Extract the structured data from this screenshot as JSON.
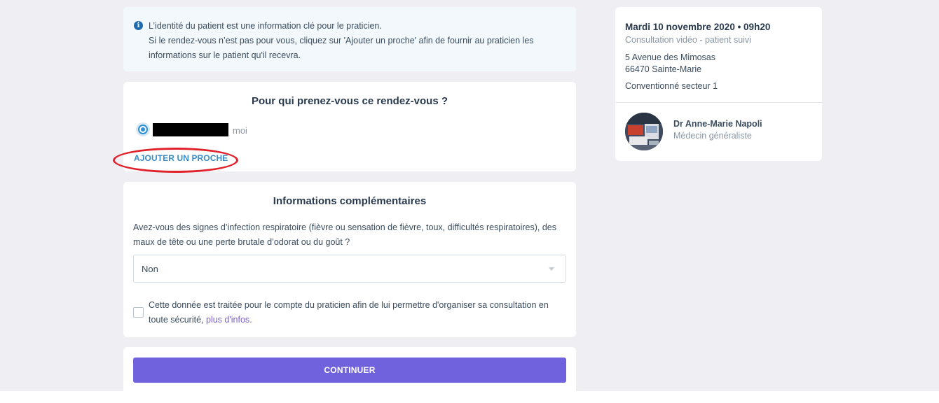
{
  "notice": {
    "line1": "L’identité du patient est une information clé pour le praticien.",
    "line2": "Si le rendez-vous n’est pas pour vous, cliquez sur 'Ajouter un proche' afin de fournir au praticien les",
    "line3": "informations sur le patient qu'il recevra."
  },
  "who": {
    "title": "Pour qui prenez-vous ce rendez-vous ?",
    "option_suffix": "moi",
    "add_relative": "AJOUTER UN PROCHE"
  },
  "extra": {
    "title": "Informations complémentaires",
    "question_line1": "Avez-vous des signes d’infection respiratoire (fièvre ou sensation de fièvre, toux, difficultés respiratoires), des",
    "question_line2": "maux de tête ou une perte brutale d’odorat ou du goût ?",
    "select_value": "Non",
    "consent_line1": "Cette donnée est traitée pour le compte du praticien afin de lui permettre d'organiser sa consultation en",
    "consent_line2_prefix": "toute sécurité,",
    "consent_link": "plus d'infos."
  },
  "actions": {
    "continue": "CONTINUER"
  },
  "appointment": {
    "datetime": "Mardi 10 novembre 2020 • 09h20",
    "type": "Consultation vidéo - patient suivi",
    "address_line1": "5 Avenue des Mimosas",
    "address_line2": "66470 Sainte-Marie",
    "sector": "Conventionné secteur 1",
    "doctor_name": "Dr Anne-Marie Napoli",
    "doctor_specialty": "Médecin généraliste"
  },
  "colors": {
    "primary_button": "#7061dc",
    "link": "#3a8dc9",
    "highlight_ellipse": "#e0202a"
  }
}
